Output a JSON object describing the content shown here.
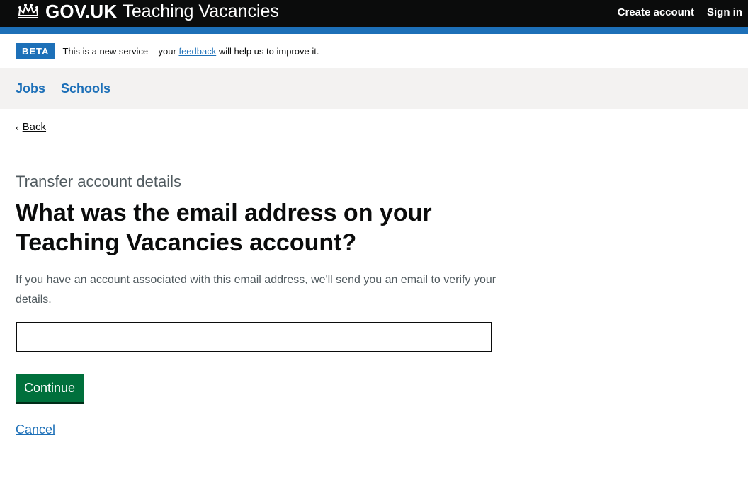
{
  "header": {
    "logo_text": "GOV.UK",
    "service_name": "Teaching Vacancies",
    "nav": {
      "create_account": "Create account",
      "sign_in": "Sign in"
    },
    "crown_icon": "crown-icon"
  },
  "phase_banner": {
    "tag": "BETA",
    "text_before": "This is a new service – your ",
    "link": "feedback",
    "text_after": " will help us to improve it."
  },
  "subnav": {
    "items": [
      {
        "label": "Jobs"
      },
      {
        "label": "Schools"
      }
    ]
  },
  "main": {
    "back_label": "Back",
    "caption": "Transfer account details",
    "heading": "What was the email address on your Teaching Vacancies account?",
    "hint": "If you have an account associated with this email address, we'll send you an email to verify your details.",
    "email_value": "",
    "continue_label": "Continue",
    "cancel_label": "Cancel"
  },
  "colors": {
    "header_bg": "#0b0c0c",
    "brand_blue": "#1d70b8",
    "button_green": "#00703c",
    "subnav_bg": "#f3f2f1"
  }
}
